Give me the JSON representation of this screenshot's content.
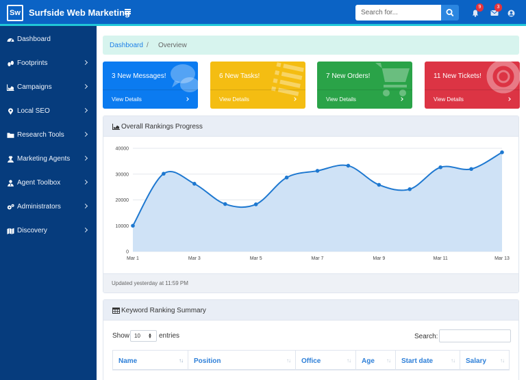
{
  "app": {
    "logo_text": "Sw",
    "title": "Surfside Web Marketing"
  },
  "search": {
    "placeholder": "Search for..."
  },
  "notifications": {
    "alerts_count": "9",
    "messages_count": "3"
  },
  "sidebar": {
    "items": [
      {
        "label": "Dashboard",
        "icon": "tachometer-icon",
        "has_chevron": false
      },
      {
        "label": "Footprints",
        "icon": "footprints-icon",
        "has_chevron": true
      },
      {
        "label": "Campaigns",
        "icon": "area-chart-icon",
        "has_chevron": true
      },
      {
        "label": "Local SEO",
        "icon": "map-marker-icon",
        "has_chevron": true
      },
      {
        "label": "Research Tools",
        "icon": "folder-icon",
        "has_chevron": true
      },
      {
        "label": "Marketing Agents",
        "icon": "user-secret-icon",
        "has_chevron": true
      },
      {
        "label": "Agent Toolbox",
        "icon": "user-tie-icon",
        "has_chevron": true
      },
      {
        "label": "Administrators",
        "icon": "cogs-icon",
        "has_chevron": true
      },
      {
        "label": "Discovery",
        "icon": "map-icon",
        "has_chevron": true
      }
    ]
  },
  "breadcrumb": {
    "link": "Dashboard",
    "separator": "/",
    "current": "Overview"
  },
  "cards": [
    {
      "title": "3 New Messages!",
      "link": "View Details",
      "color": "#0b7bf0",
      "icon": "comments-icon"
    },
    {
      "title": "6 New Tasks!",
      "link": "View Details",
      "color": "#f4bd12",
      "icon": "tasks-icon"
    },
    {
      "title": "7 New Orders!",
      "link": "View Details",
      "color": "#2aa348",
      "icon": "shopping-cart-icon"
    },
    {
      "title": "11 New Tickets!",
      "link": "View Details",
      "color": "#dc3444",
      "icon": "life-ring-icon"
    }
  ],
  "rankings_panel": {
    "title": "Overall Rankings Progress",
    "footer": "Updated yesterday at 11:59 PM"
  },
  "chart_data": {
    "type": "area",
    "title": "Overall Rankings Progress",
    "xlabel": "",
    "ylabel": "",
    "x": [
      "Mar 1",
      "Mar 2",
      "Mar 3",
      "Mar 4",
      "Mar 5",
      "Mar 6",
      "Mar 7",
      "Mar 8",
      "Mar 9",
      "Mar 10",
      "Mar 11",
      "Mar 12",
      "Mar 13"
    ],
    "x_tick_labels": [
      "Mar 1",
      "Mar 3",
      "Mar 5",
      "Mar 7",
      "Mar 9",
      "Mar 11",
      "Mar 13"
    ],
    "y_tick_labels": [
      "0",
      "10000",
      "20000",
      "30000",
      "40000"
    ],
    "values": [
      10000,
      30162,
      26263,
      18394,
      18287,
      28682,
      31274,
      33259,
      25849,
      24159,
      32651,
      31984,
      38451
    ],
    "ylim": [
      0,
      40000
    ],
    "grid": true,
    "line_color": "#1e78d0",
    "fill_color": "#cfe2f6"
  },
  "keyword_panel": {
    "title": "Keyword Ranking Summary",
    "show_label": "Show",
    "entries_value": "10",
    "entries_label": "entries",
    "search_label": "Search:",
    "columns": [
      "Name",
      "Position",
      "Office",
      "Age",
      "Start date",
      "Salary"
    ]
  }
}
